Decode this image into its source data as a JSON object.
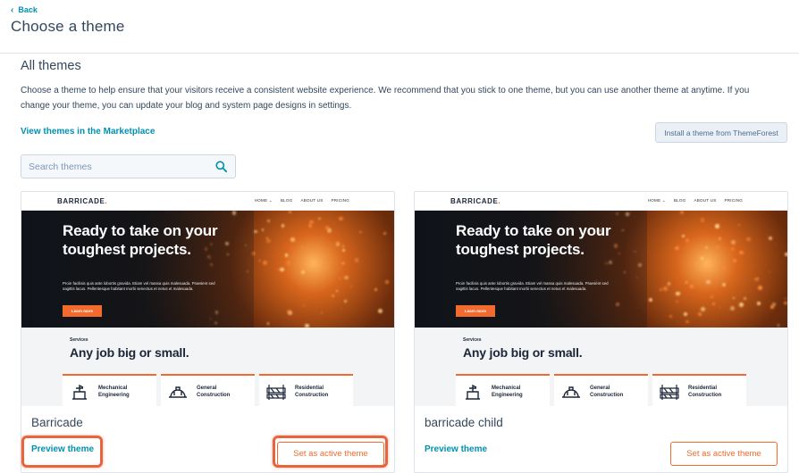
{
  "header": {
    "back_label": "Back",
    "title": "Choose a theme"
  },
  "section": {
    "title": "All themes",
    "description": "Choose a theme to help ensure that your visitors receive a consistent website experience. We recommend that you stick to one theme, but you can use another theme at anytime. If you change your theme, you can update your blog and system page designs in settings.",
    "marketplace_link": "View themes in the Marketplace",
    "install_button": "Install a theme from ThemeForest"
  },
  "search": {
    "placeholder": "Search themes",
    "value": ""
  },
  "preview": {
    "logo": "BARRICADE",
    "logo_dot": ".",
    "nav": [
      "HOME ⌄",
      "BLOG",
      "ABOUT US",
      "PRICING"
    ],
    "hero_title": "Ready to take on your toughest projects.",
    "hero_body": "Proin facilisis quis ante lobortis gravida. Etiam vel massa quis malesuada. Praesent sed sagittis lacus. Pellentesque habitant morbi senectus et netus et malesuada.",
    "hero_button": "Learn more",
    "services_label": "Services",
    "services_title": "Any job big or small.",
    "services": [
      "Mechanical Engineering",
      "General Construction",
      "Residential Construction"
    ]
  },
  "themes": [
    {
      "name": "Barricade",
      "preview_label": "Preview theme",
      "active_label": "Set as active theme"
    },
    {
      "name": "barricade child",
      "preview_label": "Preview theme",
      "active_label": "Set as active theme"
    }
  ],
  "colors": {
    "link": "#0091ae",
    "accent": "#f26a2e",
    "highlight": "#e8643c",
    "text": "#33475b"
  },
  "icons": [
    "chevron-left-icon",
    "search-icon",
    "crane-icon",
    "hardhat-icon",
    "barricade-icon"
  ]
}
